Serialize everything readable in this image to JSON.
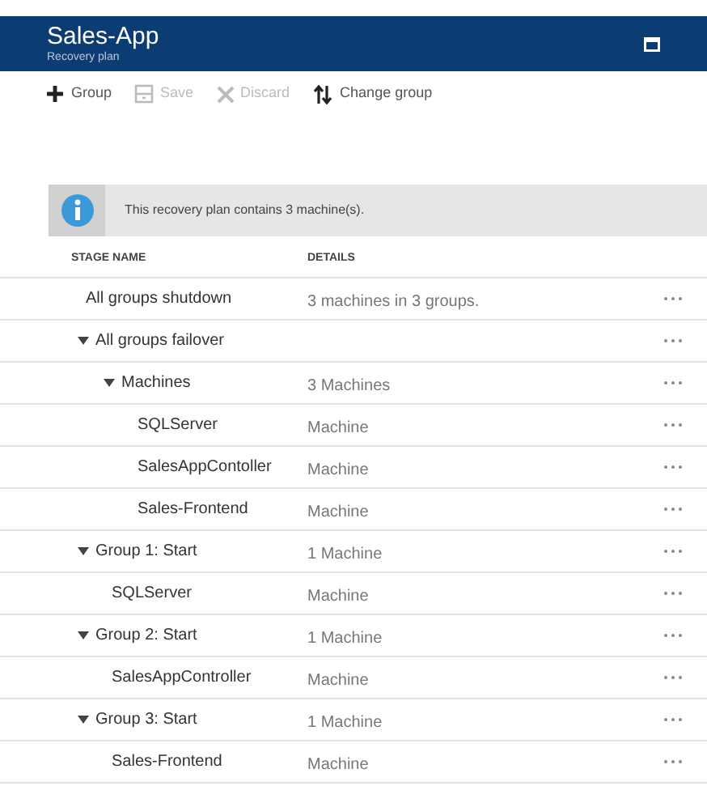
{
  "window": {
    "title": "Sales-App",
    "subtitle": "Recovery plan"
  },
  "toolbar": [
    {
      "label": "Group",
      "kind": "add",
      "disabled": false
    },
    {
      "label": "Save",
      "kind": "save",
      "disabled": true
    },
    {
      "label": "Discard",
      "kind": "discard",
      "disabled": true
    },
    {
      "label": "Change group",
      "kind": "reorder",
      "disabled": false
    }
  ],
  "info": {
    "message": "This recovery plan contains 3 machine(s)."
  },
  "table": {
    "columns": [
      "STAGE NAME",
      "DETAILS"
    ],
    "rows": [
      {
        "name": "All groups shutdown",
        "details": "3 machines in 3 groups."
      },
      {
        "name": "All groups failover",
        "expanded": true,
        "children": [
          {
            "name": "Machines",
            "details": "3 Machines",
            "expanded": true,
            "children": [
              {
                "name": "SQLServer",
                "details": "Machine"
              },
              {
                "name": "SalesAppContoller",
                "details": "Machine"
              },
              {
                "name": "Sales-Frontend",
                "details": "Machine"
              }
            ]
          }
        ]
      },
      {
        "name": "Group 1: Start",
        "details": "1 Machine",
        "expanded": true,
        "children": [
          {
            "name": "SQLServer",
            "details": "Machine"
          }
        ]
      },
      {
        "name": "Group 2: Start",
        "details": "1 Machine",
        "expanded": true,
        "children": [
          {
            "name": "SalesAppController",
            "details": "Machine"
          }
        ]
      },
      {
        "name": "Group 3: Start",
        "details": "1 Machine",
        "expanded": true,
        "children": [
          {
            "name": "Sales-Frontend",
            "details": "Machine"
          }
        ]
      }
    ]
  }
}
